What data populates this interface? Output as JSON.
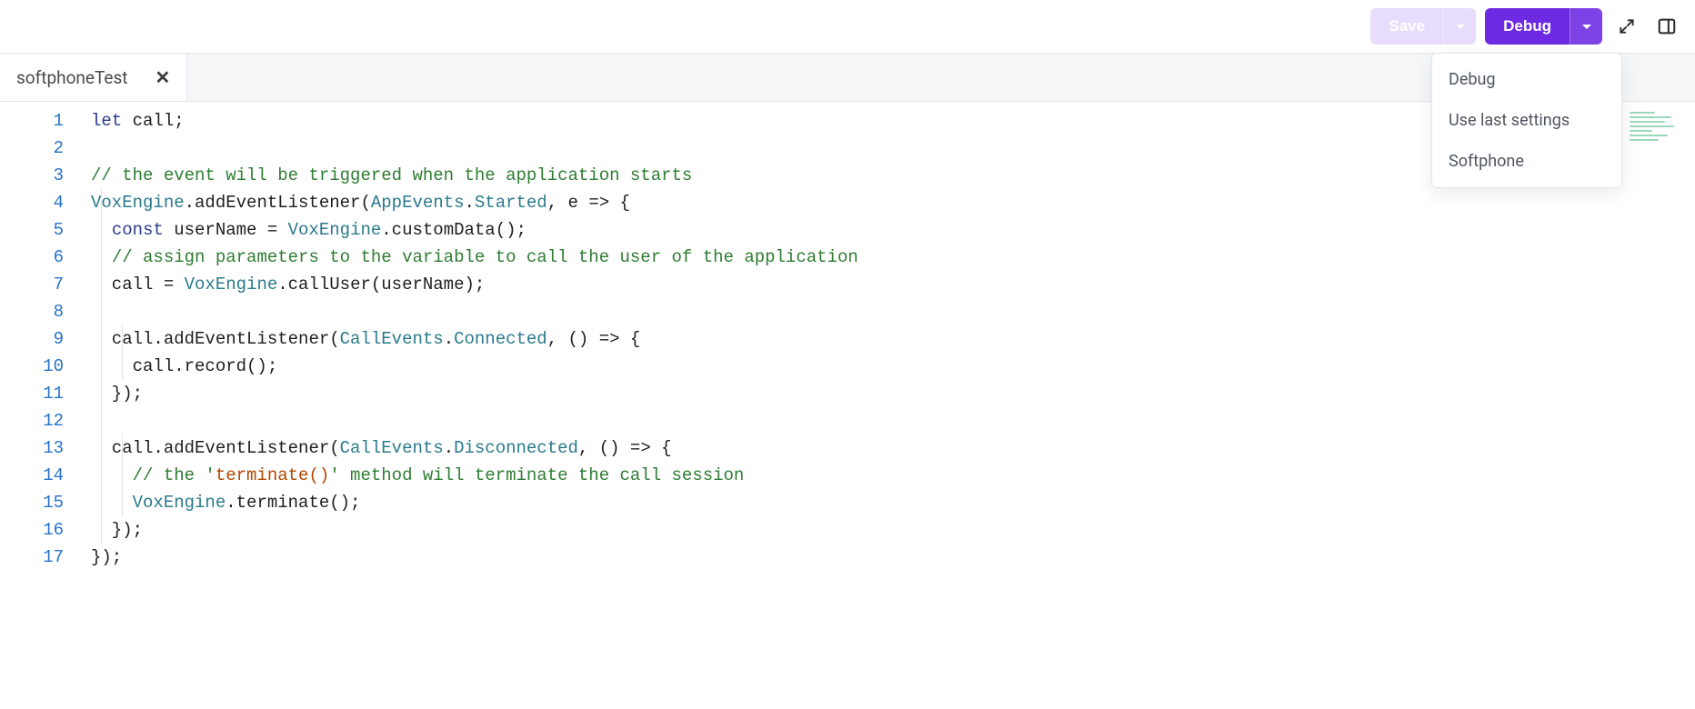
{
  "toolbar": {
    "save_label": "Save",
    "debug_label": "Debug"
  },
  "tabs": [
    {
      "label": "softphoneTest"
    }
  ],
  "menu": {
    "items": [
      {
        "label": "Debug"
      },
      {
        "label": "Use last settings"
      },
      {
        "label": "Softphone"
      }
    ]
  },
  "editor": {
    "line_numbers": [
      "1",
      "2",
      "3",
      "4",
      "5",
      "6",
      "7",
      "8",
      "9",
      "10",
      "11",
      "12",
      "13",
      "14",
      "15",
      "16",
      "17"
    ],
    "code_lines": [
      "let call;",
      "",
      "// the event will be triggered when the application starts",
      "VoxEngine.addEventListener(AppEvents.Started, e => {",
      "  const userName = VoxEngine.customData();",
      "  // assign parameters to the variable to call the user of the application",
      "  call = VoxEngine.callUser(userName);",
      "",
      "  call.addEventListener(CallEvents.Connected, () => {",
      "    call.record();",
      "  });",
      "",
      "  call.addEventListener(CallEvents.Disconnected, () => {",
      "    // the 'terminate()' method will terminate the call session",
      "    VoxEngine.terminate();",
      "  });",
      "});"
    ]
  }
}
